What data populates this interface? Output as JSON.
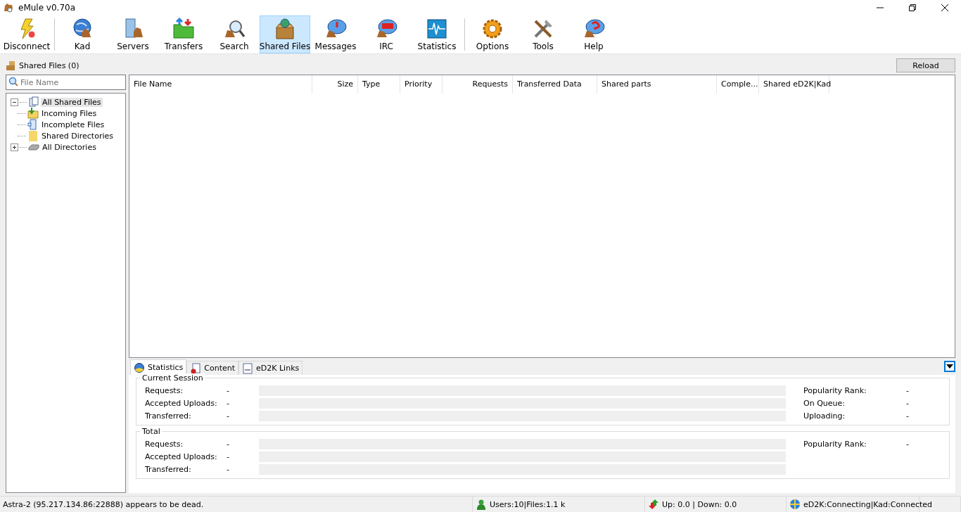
{
  "window": {
    "title": "eMule v0.70a"
  },
  "toolbar": [
    {
      "label": "Disconnect",
      "selected": false
    },
    {
      "label": "Kad",
      "selected": false
    },
    {
      "label": "Servers",
      "selected": false
    },
    {
      "label": "Transfers",
      "selected": false
    },
    {
      "label": "Search",
      "selected": false
    },
    {
      "label": "Shared Files",
      "selected": true
    },
    {
      "label": "Messages",
      "selected": false
    },
    {
      "label": "IRC",
      "selected": false
    },
    {
      "label": "Statistics",
      "selected": false
    },
    {
      "label": "Options",
      "selected": false
    },
    {
      "label": "Tools",
      "selected": false
    },
    {
      "label": "Help",
      "selected": false
    }
  ],
  "header": {
    "title": "Shared Files (0)",
    "reload_button": "Reload"
  },
  "search": {
    "placeholder": "File Name"
  },
  "tree": [
    {
      "label": "All Shared Files",
      "selected": true,
      "expanded": true,
      "children": [
        {
          "label": "Incoming Files",
          "selected": false
        },
        {
          "label": "Incomplete Files",
          "selected": false
        },
        {
          "label": "Shared Directories",
          "selected": false
        }
      ]
    },
    {
      "label": "All Directories",
      "selected": false,
      "expanded": false
    }
  ],
  "table": {
    "columns": [
      "File Name",
      "Size",
      "Type",
      "Priority",
      "Requests",
      "Transferred Data",
      "Shared parts",
      "Comple...",
      "Shared eD2K|Kad"
    ]
  },
  "detail_tabs": [
    {
      "label": "Statistics",
      "selected": true
    },
    {
      "label": "Content",
      "selected": false
    },
    {
      "label": "eD2K Links",
      "selected": false
    }
  ],
  "stats_groups": [
    {
      "title": "Current Session",
      "labels": [
        "Requests:",
        "Accepted Uploads:",
        "Transferred:"
      ],
      "values": [
        "-",
        "-",
        "-"
      ],
      "side": [
        {
          "label": "Popularity Rank:",
          "value": "-"
        },
        {
          "label": "On Queue:",
          "value": "-"
        },
        {
          "label": "Uploading:",
          "value": "-"
        }
      ]
    },
    {
      "title": "Total",
      "labels": [
        "Requests:",
        "Accepted Uploads:",
        "Transferred:"
      ],
      "values": [
        "-",
        "-",
        "-"
      ],
      "side": [
        {
          "label": "Popularity Rank:",
          "value": "-"
        }
      ]
    }
  ],
  "status_bar": {
    "message": "Astra-2 (95.217.134.86:22888) appears to be dead.",
    "users": "Users:10|Files:1.1 k",
    "traffic": "Up: 0.0 | Down: 0.0",
    "connection": "eD2K:Connecting|Kad:Connected"
  }
}
